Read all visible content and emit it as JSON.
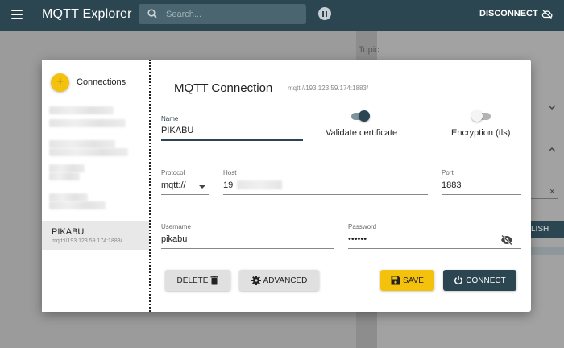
{
  "app": {
    "title": "MQTT Explorer",
    "disconnect_label": "DISCONNECT"
  },
  "search": {
    "placeholder": "Search..."
  },
  "background": {
    "topic_label": "Topic",
    "publish_label": "LISH",
    "clear_symbol": "×"
  },
  "dialog": {
    "sidebar_title": "Connections",
    "add_symbol": "+",
    "selected_connection": {
      "name": "PIKABU",
      "host": "mqtt://193.123.59.174:1883/"
    },
    "title": "MQTT Connection",
    "url": "mqtt://193.123.59.174:1883/",
    "name": {
      "label": "Name",
      "value": "PIKABU"
    },
    "validate_certificate": {
      "label": "Validate certificate",
      "checked": true
    },
    "encryption": {
      "label": "Encryption (tls)",
      "checked": false
    },
    "protocol": {
      "label": "Protocol",
      "value": "mqtt://"
    },
    "host": {
      "label": "Host",
      "value": "19"
    },
    "port": {
      "label": "Port",
      "value": "1883"
    },
    "username": {
      "label": "Username",
      "value": "pikabu"
    },
    "password": {
      "label": "Password",
      "value": "••••••"
    },
    "buttons": {
      "delete": "DELETE",
      "advanced": "ADVANCED",
      "save": "SAVE",
      "connect": "CONNECT"
    }
  },
  "colors": {
    "primary": "#2c4651",
    "accent": "#f4c20d"
  }
}
